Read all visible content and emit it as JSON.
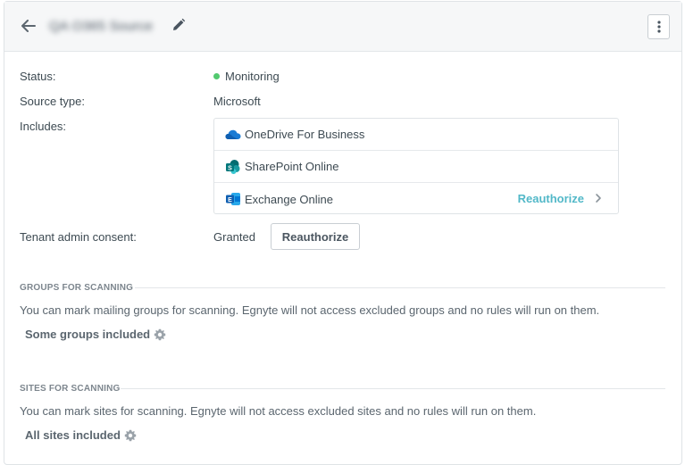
{
  "header": {
    "title": "QA O365 Source"
  },
  "details": {
    "status_label": "Status:",
    "status_value": "Monitoring",
    "status_color": "#52c96f",
    "source_type_label": "Source type:",
    "source_type_value": "Microsoft",
    "includes_label": "Includes:",
    "services": [
      {
        "name": "OneDrive For Business",
        "icon": "onedrive-icon"
      },
      {
        "name": "SharePoint Online",
        "icon": "sharepoint-icon"
      },
      {
        "name": "Exchange Online",
        "icon": "exchange-icon",
        "action": "Reauthorize"
      }
    ],
    "consent_label": "Tenant admin consent:",
    "consent_value": "Granted",
    "consent_button": "Reauthorize"
  },
  "groups": {
    "heading": "GROUPS FOR SCANNING",
    "description": "You can mark mailing groups for scanning. Egnyte will not access excluded groups and no rules will run on them.",
    "included": "Some groups included"
  },
  "sites": {
    "heading": "SITES FOR SCANNING",
    "description": "You can mark sites for scanning. Egnyte will not access excluded sites and no rules will run on them.",
    "included": "All sites included"
  },
  "colors": {
    "accent": "#52b8c8"
  }
}
